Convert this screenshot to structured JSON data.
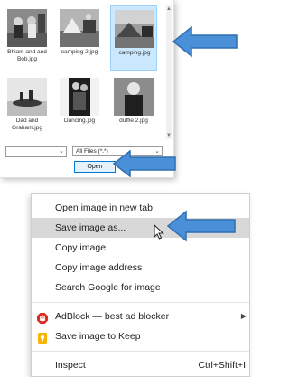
{
  "dialog": {
    "thumbnails": [
      {
        "name": "Bhiam and and Bob.jpg",
        "selected": false
      },
      {
        "name": "camping 2.jpg",
        "selected": false
      },
      {
        "name": "camping.jpg",
        "selected": true
      },
      {
        "name": "Dad and Graham.jpg",
        "selected": false
      },
      {
        "name": "Dancing.jpg",
        "selected": false
      },
      {
        "name": "duffle 2.jpg",
        "selected": false
      }
    ],
    "filename_value": "",
    "filter_label": "All Files (*.*)",
    "open_label": "Open"
  },
  "menu": {
    "items": [
      {
        "label": "Open image in new tab"
      },
      {
        "label": "Save image as..."
      },
      {
        "label": "Copy image"
      },
      {
        "label": "Copy image address"
      },
      {
        "label": "Search Google for image"
      },
      {
        "label": "AdBlock — best ad blocker",
        "icon": "adblock-icon"
      },
      {
        "label": "Save image to Keep",
        "icon": "keep-icon"
      },
      {
        "label": "Inspect",
        "shortcut": "Ctrl+Shift+I"
      }
    ]
  },
  "colors": {
    "arrow_blue": "#4a90d9",
    "selection": "#cce8ff",
    "menu_hover": "#d8d8d8",
    "adblock_red": "#e02b20",
    "keep_yellow": "#f7b500"
  }
}
